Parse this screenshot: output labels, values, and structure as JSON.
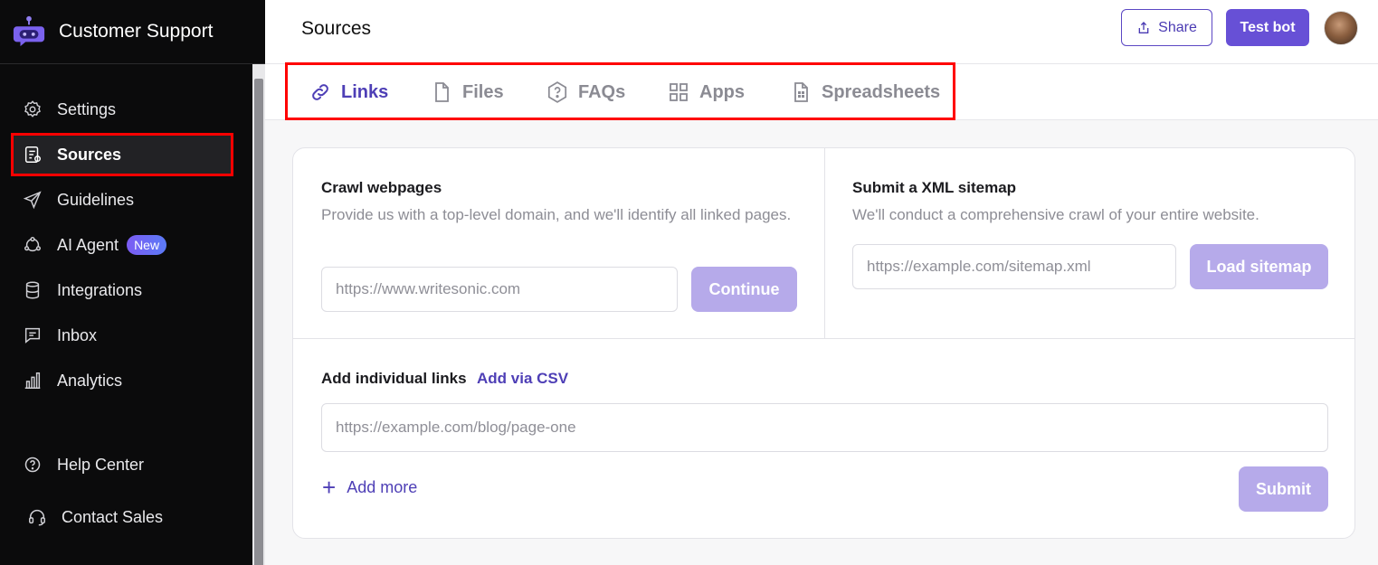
{
  "app": {
    "title": "Customer Support"
  },
  "sidebar": {
    "items": [
      {
        "label": "Settings",
        "icon": "gear-icon"
      },
      {
        "label": "Sources",
        "icon": "document-icon",
        "active": true
      },
      {
        "label": "Guidelines",
        "icon": "send-icon"
      },
      {
        "label": "AI Agent",
        "icon": "agent-icon",
        "badge": "New"
      },
      {
        "label": "Integrations",
        "icon": "database-icon"
      },
      {
        "label": "Inbox",
        "icon": "message-icon"
      },
      {
        "label": "Analytics",
        "icon": "chart-icon"
      }
    ],
    "footer": [
      {
        "label": "Help Center",
        "icon": "help-circle-icon"
      },
      {
        "label": "Contact Sales",
        "icon": "headset-icon"
      }
    ]
  },
  "header": {
    "title": "Sources",
    "share_label": "Share",
    "test_label": "Test bot"
  },
  "tabs": [
    {
      "label": "Links",
      "icon": "link-icon",
      "active": true
    },
    {
      "label": "Files",
      "icon": "file-icon"
    },
    {
      "label": "FAQs",
      "icon": "question-hexagon-icon"
    },
    {
      "label": "Apps",
      "icon": "apps-grid-icon"
    },
    {
      "label": "Spreadsheets",
      "icon": "spreadsheet-icon"
    }
  ],
  "crawl": {
    "title": "Crawl webpages",
    "description": "Provide us with a top-level domain, and we'll identify all linked pages.",
    "placeholder": "https://www.writesonic.com",
    "button": "Continue"
  },
  "sitemap": {
    "title": "Submit a XML sitemap",
    "description": "We'll conduct a comprehensive crawl of your entire website.",
    "placeholder": "https://example.com/sitemap.xml",
    "button": "Load sitemap"
  },
  "individual": {
    "title": "Add individual links",
    "csv_label": "Add via CSV",
    "placeholder": "https://example.com/blog/page-one",
    "add_more": "Add more",
    "submit": "Submit"
  },
  "colors": {
    "accent": "#6750d6",
    "accent_disabled": "#b6aaea",
    "highlight": "#ff0000"
  }
}
